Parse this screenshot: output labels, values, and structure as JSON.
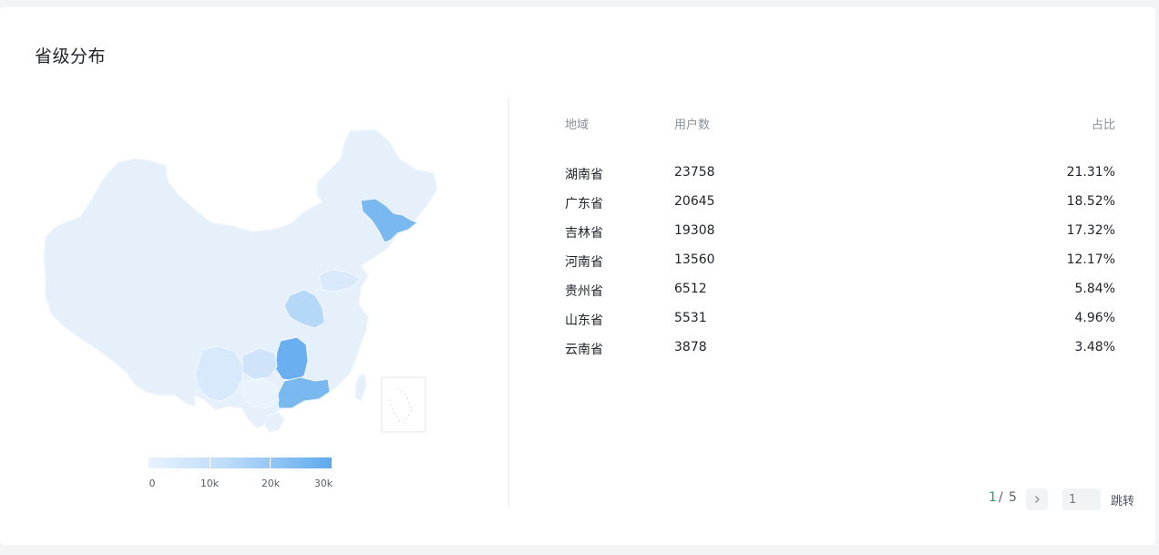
{
  "card": {
    "title": "省级分布"
  },
  "legend": {
    "ticks": [
      "0",
      "10k",
      "20k",
      "30k"
    ]
  },
  "table": {
    "headers": {
      "region": "地域",
      "users": "用户数",
      "ratio": "占比"
    },
    "rows": [
      {
        "region": "湖南省",
        "users": "23758",
        "ratio": "21.31%"
      },
      {
        "region": "广东省",
        "users": "20645",
        "ratio": "18.52%"
      },
      {
        "region": "吉林省",
        "users": "19308",
        "ratio": "17.32%"
      },
      {
        "region": "河南省",
        "users": "13560",
        "ratio": "12.17%"
      },
      {
        "region": "贵州省",
        "users": "6512",
        "ratio": "5.84%"
      },
      {
        "region": "山东省",
        "users": "5531",
        "ratio": "4.96%"
      },
      {
        "region": "云南省",
        "users": "3878",
        "ratio": "3.48%"
      }
    ]
  },
  "pagination": {
    "current": "1",
    "separator": "/",
    "total": "5",
    "input_placeholder": "1",
    "jump_label": "跳转",
    "next_icon": "chevron-right-icon"
  },
  "colors": {
    "scale_min": "#e8f3fd",
    "scale_mid": "#b9daf8",
    "scale_max": "#5eaaee",
    "base_fill": "#e5f0fb",
    "page_current": "#22a35a"
  }
}
